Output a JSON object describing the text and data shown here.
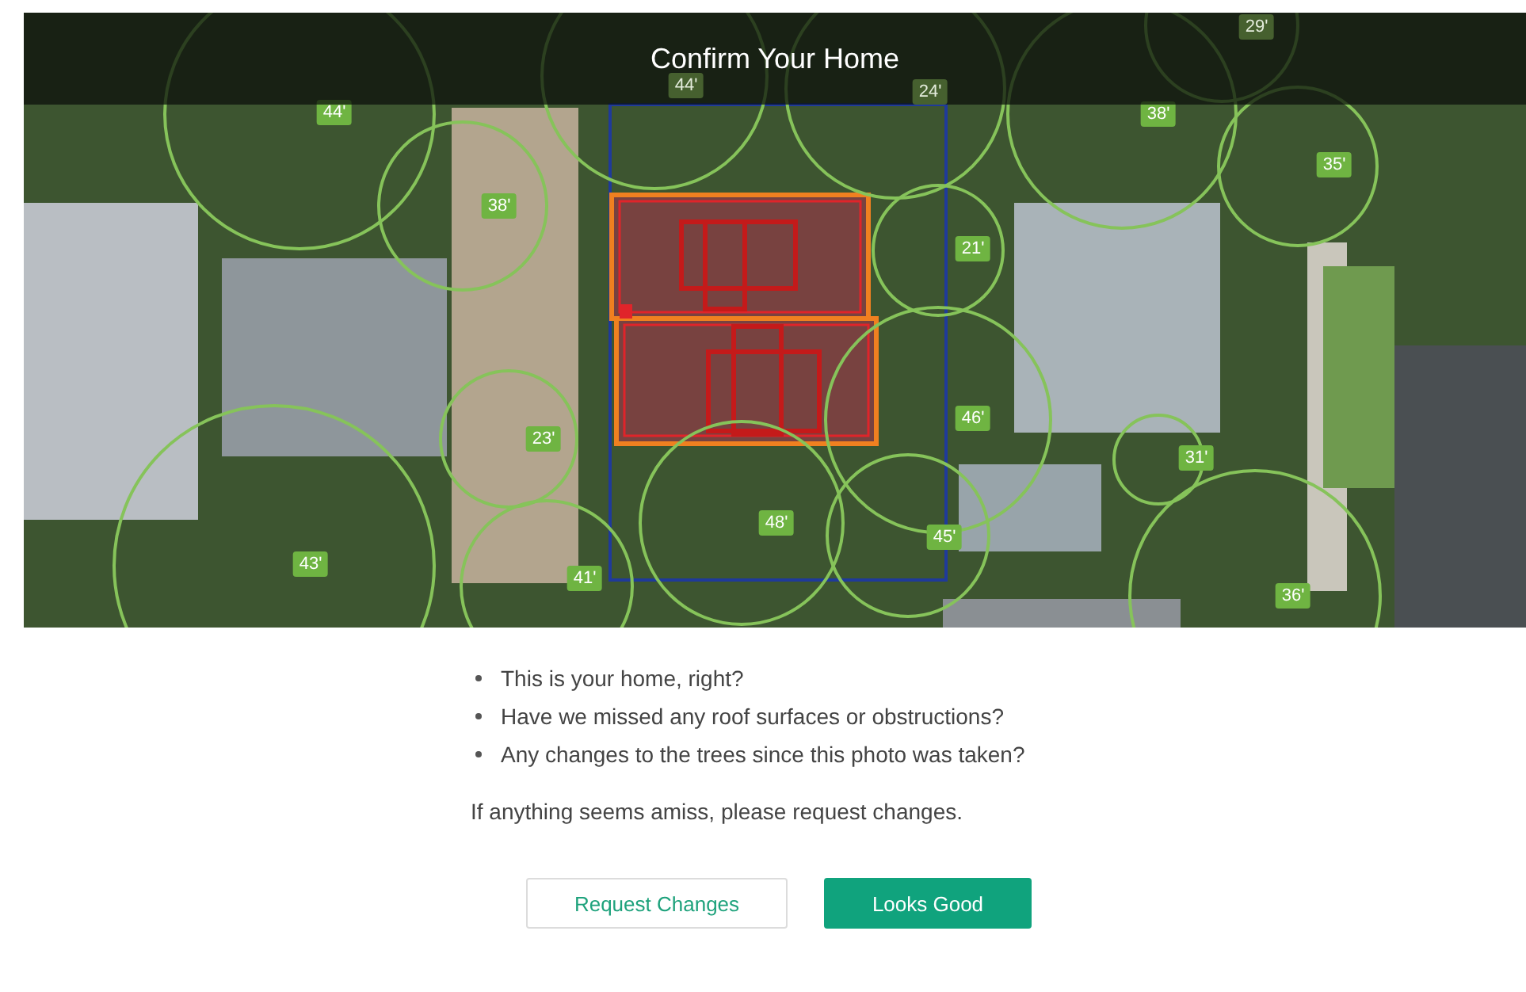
{
  "map": {
    "title": "Confirm Your Home",
    "trees": [
      {
        "label": "44'",
        "dimmed": false
      },
      {
        "label": "38'",
        "dimmed": false
      },
      {
        "label": "23'",
        "dimmed": false
      },
      {
        "label": "41'",
        "dimmed": false
      },
      {
        "label": "43'",
        "dimmed": false
      },
      {
        "label": "44'",
        "dimmed": true
      },
      {
        "label": "24'",
        "dimmed": true
      },
      {
        "label": "29'",
        "dimmed": true
      },
      {
        "label": "38'",
        "dimmed": false
      },
      {
        "label": "35'",
        "dimmed": false
      },
      {
        "label": "21'",
        "dimmed": false
      },
      {
        "label": "46'",
        "dimmed": false
      },
      {
        "label": "48'",
        "dimmed": false
      },
      {
        "label": "45'",
        "dimmed": false
      },
      {
        "label": "31'",
        "dimmed": false
      },
      {
        "label": "36'",
        "dimmed": false
      }
    ]
  },
  "questions": [
    "This is your home, right?",
    "Have we missed any roof surfaces or obstructions?",
    "Any changes to the trees since this photo was taken?"
  ],
  "note": "If anything seems amiss, please request changes.",
  "buttons": [
    {
      "label": "Request Changes",
      "kind": "secondary"
    },
    {
      "label": "Looks Good",
      "kind": "primary"
    }
  ]
}
